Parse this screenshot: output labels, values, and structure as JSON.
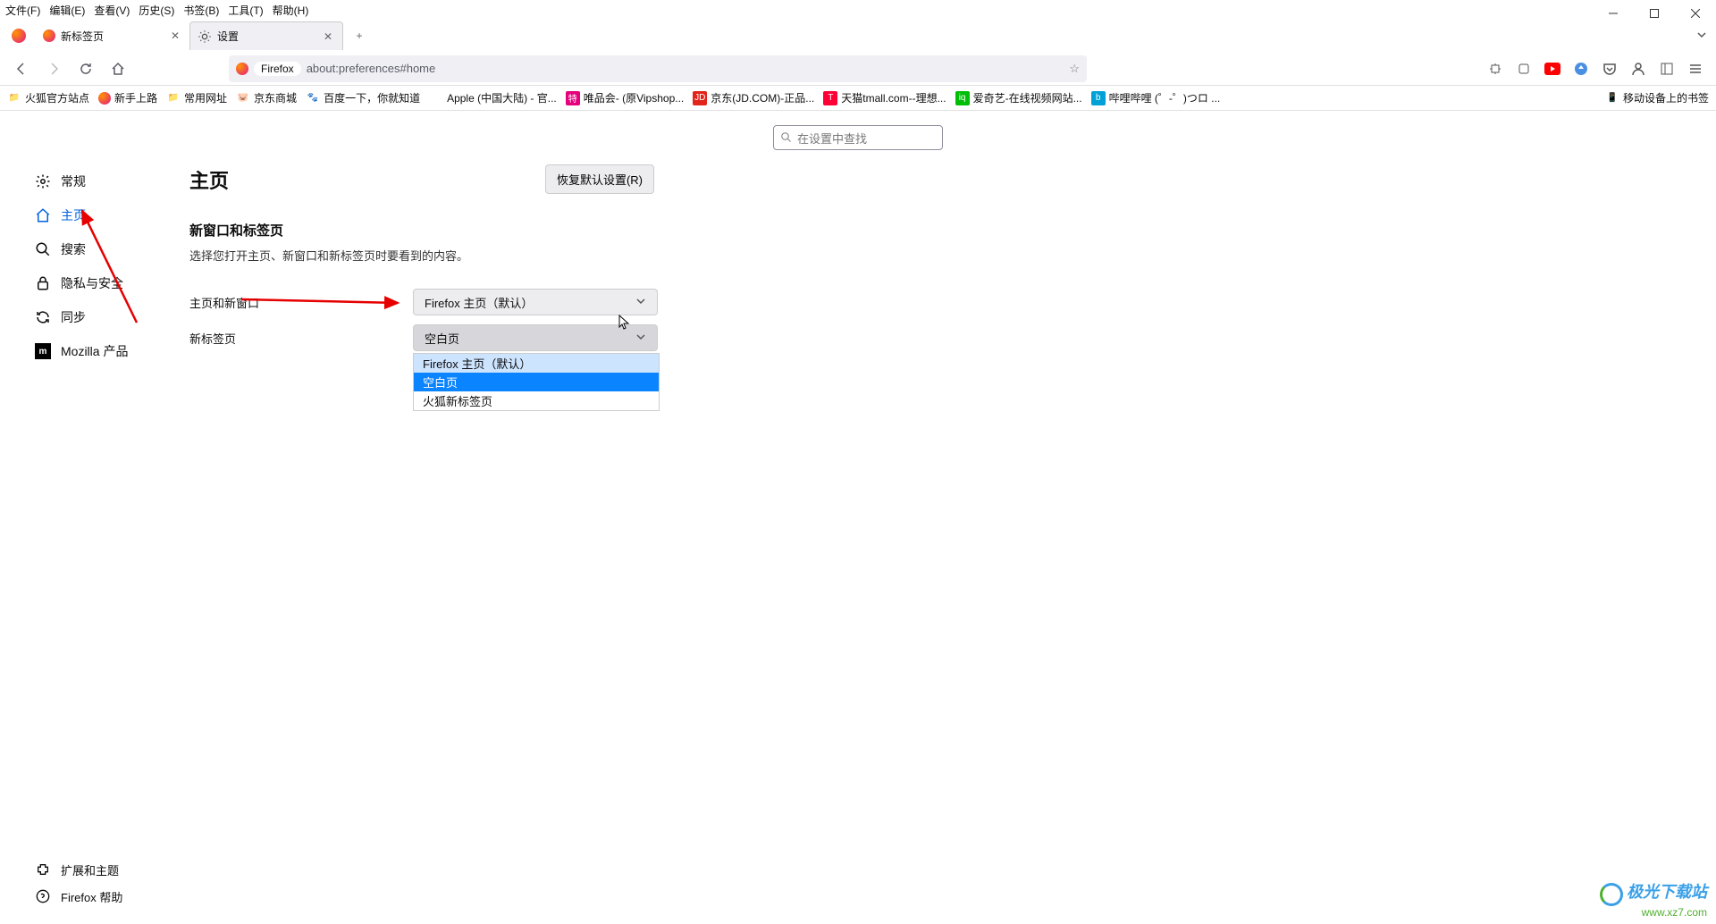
{
  "menus": [
    "文件(F)",
    "编辑(E)",
    "查看(V)",
    "历史(S)",
    "书签(B)",
    "工具(T)",
    "帮助(H)"
  ],
  "tabs": [
    {
      "title": "新标签页",
      "active": false
    },
    {
      "title": "设置",
      "active": true
    }
  ],
  "url": {
    "label": "Firefox",
    "path": "about:preferences#home"
  },
  "bookmarks": [
    {
      "label": "火狐官方站点",
      "icon": "folder"
    },
    {
      "label": "新手上路",
      "icon": "ff"
    },
    {
      "label": "常用网址",
      "icon": "folder"
    },
    {
      "label": "京东商城",
      "icon": "jd-pig"
    },
    {
      "label": "百度一下，你就知道",
      "icon": "baidu"
    },
    {
      "label": "Apple (中国大陆) - 官...",
      "icon": "apple"
    },
    {
      "label": "唯品会- (原Vipshop...",
      "icon": "vip"
    },
    {
      "label": "京东(JD.COM)-正品...",
      "icon": "jd"
    },
    {
      "label": "天猫tmall.com--理想...",
      "icon": "tmall"
    },
    {
      "label": "爱奇艺-在线视频网站...",
      "icon": "iqiyi"
    },
    {
      "label": "哔哩哔哩 (゜-゜)つロ ...",
      "icon": "bili"
    }
  ],
  "bookmarks_right": "移动设备上的书签",
  "settings_search_placeholder": "在设置中查找",
  "sidebar": {
    "items": [
      {
        "id": "general",
        "label": "常规"
      },
      {
        "id": "home",
        "label": "主页"
      },
      {
        "id": "search",
        "label": "搜索"
      },
      {
        "id": "privacy",
        "label": "隐私与安全"
      },
      {
        "id": "sync",
        "label": "同步"
      },
      {
        "id": "mozilla",
        "label": "Mozilla 产品"
      }
    ],
    "bottom": [
      {
        "id": "addons",
        "label": "扩展和主题"
      },
      {
        "id": "help",
        "label": "Firefox 帮助"
      }
    ]
  },
  "page": {
    "title": "主页",
    "restore_btn": "恢复默认设置(R)",
    "section_title": "新窗口和标签页",
    "section_desc": "选择您打开主页、新窗口和新标签页时要看到的内容。",
    "row1_label": "主页和新窗口",
    "row1_value": "Firefox 主页（默认）",
    "row2_label": "新标签页",
    "row2_value": "空白页",
    "dropdown": [
      {
        "label": "Firefox 主页（默认）",
        "state": "hover"
      },
      {
        "label": "空白页",
        "state": "selected"
      },
      {
        "label": "火狐新标签页",
        "state": ""
      }
    ]
  },
  "watermark": {
    "line1": "极光下载站",
    "line2": "www.xz7.com"
  }
}
